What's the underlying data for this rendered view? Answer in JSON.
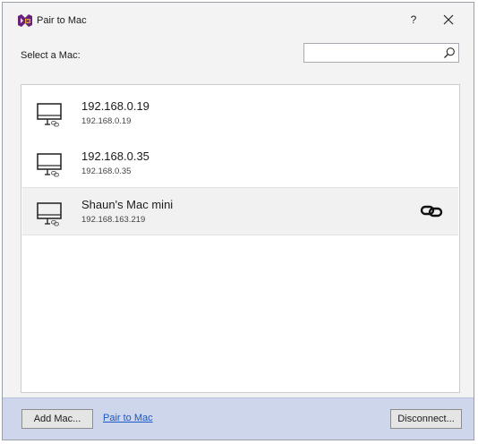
{
  "window": {
    "title": "Pair to Mac",
    "help_label": "?",
    "close_label": "close",
    "app_icon": "xamarin-vs-icon"
  },
  "main": {
    "select_label": "Select a Mac:",
    "search": {
      "value": "",
      "placeholder": "",
      "icon": "search-icon"
    },
    "macs": [
      {
        "name": "192.168.0.19",
        "ip": "192.168.0.19",
        "icon": "mac-monitor-icon",
        "connected": false
      },
      {
        "name": "192.168.0.35",
        "ip": "192.168.0.35",
        "icon": "mac-monitor-icon",
        "connected": false
      },
      {
        "name": "Shaun's Mac mini",
        "ip": "192.168.163.219",
        "icon": "mac-monitor-icon",
        "connected": true,
        "selected": true
      }
    ]
  },
  "footer": {
    "add_mac_label": "Add Mac...",
    "pair_link_label": "Pair to Mac",
    "disconnect_label": "Disconnect..."
  },
  "colors": {
    "footer_bg": "#cdd6ea",
    "link": "#1a57c8",
    "selected_row": "#f1f1f1",
    "window_bg": "#f3f3f3"
  }
}
